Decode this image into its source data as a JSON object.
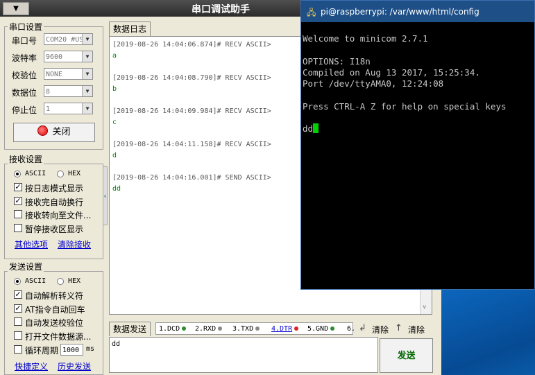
{
  "app": {
    "title": "串口调试助手",
    "sysmenu_label": "▼"
  },
  "port_settings": {
    "title": "串口设置",
    "fields": [
      {
        "label": "串口号",
        "value": "COM20 #US"
      },
      {
        "label": "波特率",
        "value": "9600"
      },
      {
        "label": "校验位",
        "value": "NONE"
      },
      {
        "label": "数据位",
        "value": "8"
      },
      {
        "label": "停止位",
        "value": "1"
      }
    ],
    "close_button": "关闭"
  },
  "receive_settings": {
    "title": "接收设置",
    "mode_ascii": "ASCII",
    "mode_hex": "HEX",
    "options": [
      {
        "label": "按日志模式显示",
        "checked": true
      },
      {
        "label": "接收完自动换行",
        "checked": true
      },
      {
        "label": "接收转向至文件...",
        "checked": false
      },
      {
        "label": "暂停接收区显示",
        "checked": false
      }
    ],
    "link_more": "其他选项",
    "link_clear": "清除接收"
  },
  "send_settings": {
    "title": "发送设置",
    "mode_ascii": "ASCII",
    "mode_hex": "HEX",
    "options": [
      {
        "label": "自动解析转义符",
        "checked": true
      },
      {
        "label": "AT指令自动回车",
        "checked": true
      },
      {
        "label": "自动发送校验位",
        "checked": false
      },
      {
        "label": "打开文件数据源...",
        "checked": false
      }
    ],
    "cycle_label": "循环周期",
    "cycle_value": "1000",
    "cycle_unit": "ms",
    "link_shortcut": "快捷定义",
    "link_history": "历史发送"
  },
  "log": {
    "tab": "数据日志",
    "entries": [
      {
        "header": "[2019-08-26 14:04:06.874]# RECV ASCII>",
        "data": "a"
      },
      {
        "header": "[2019-08-26 14:04:08.790]# RECV ASCII>",
        "data": "b"
      },
      {
        "header": "[2019-08-26 14:04:09.984]# RECV ASCII>",
        "data": "c"
      },
      {
        "header": "[2019-08-26 14:04:11.158]# RECV ASCII>",
        "data": "d"
      },
      {
        "header": "[2019-08-26 14:04:16.001]# SEND ASCII>",
        "data": "dd"
      }
    ]
  },
  "send_area": {
    "tab": "数据发送",
    "signals": [
      {
        "label": "1.DCD",
        "color": "#2e8b2e"
      },
      {
        "label": "2.RXD",
        "color": "#888888"
      },
      {
        "label": "3.TXD",
        "color": "#888888"
      },
      {
        "label": "4.DTR",
        "color": "#dd2222"
      },
      {
        "label": "5.GND",
        "color": "#2e8b2e"
      },
      {
        "label": "6.",
        "color": ""
      }
    ],
    "clear1": "清除",
    "clear2": "清除",
    "text": "dd",
    "send_button": "发送"
  },
  "terminal": {
    "title": "pi@raspberrypi: /var/www/html/config",
    "lines": [
      "Welcome to minicom 2.7.1",
      "",
      "OPTIONS: I18n",
      "Compiled on Aug 13 2017, 15:25:34.",
      "Port /dev/ttyAMA0, 12:24:08",
      "",
      "Press CTRL-A Z for help on special keys"
    ],
    "input": "dd"
  }
}
